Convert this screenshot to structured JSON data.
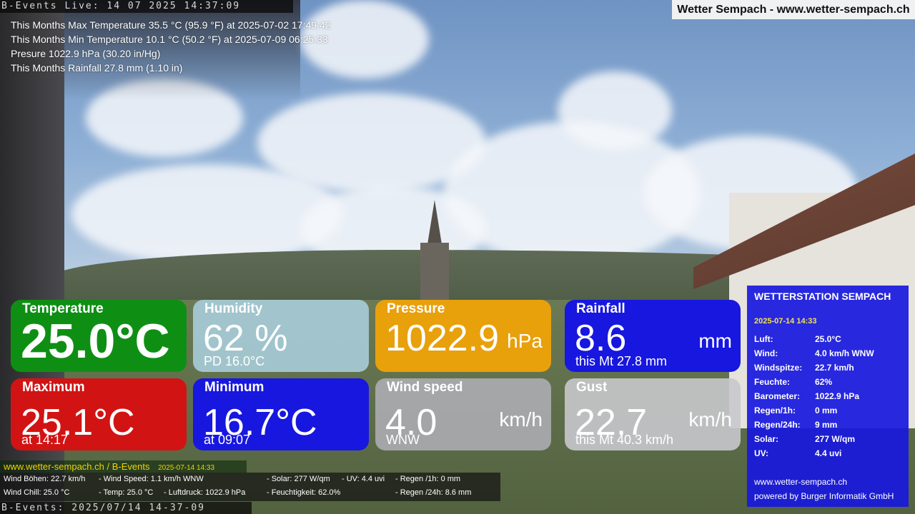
{
  "top_timestamp": "B-Events Live: 14 07 2025 14:37:09",
  "site_banner": "Wetter Sempach - www.wetter-sempach.ch",
  "stats": [
    "This Months Max Temperature 35.5 °C (95.9 °F) at 2025-07-02 17:49:42",
    "This Months Min Temperature 10.1 °C (50.2 °F) at 2025-07-09 06:25:33",
    "Presure 1022.9 hPa (30.20 in/Hg)",
    "This Months Rainfall 27.8 mm (1.10 in)"
  ],
  "tiles": {
    "temperature": {
      "title": "Temperature",
      "value": "25.0°C"
    },
    "humidity": {
      "title": "Humidity",
      "value": "62 %",
      "sub": "PD 16.0°C"
    },
    "pressure": {
      "title": "Pressure",
      "value": "1022.9",
      "unit": "hPa"
    },
    "rainfall": {
      "title": "Rainfall",
      "value": "8.6",
      "unit": "mm",
      "sub": "this Mt 27.8 mm"
    },
    "maximum": {
      "title": "Maximum",
      "value": "25.1°C",
      "sub": "at 14:17"
    },
    "minimum": {
      "title": "Minimum",
      "value": "16.7°C",
      "sub": "at 09:07"
    },
    "wind_speed": {
      "title": "Wind speed",
      "value": "4.0",
      "unit": "km/h",
      "sub": "WNW"
    },
    "gust": {
      "title": "Gust",
      "value": "22.7",
      "unit": "km/h",
      "sub": "this Mt 40.3 km/h"
    }
  },
  "station": {
    "title": "WETTERSTATION SEMPACH",
    "datetime": "2025-07-14 14:33",
    "rows": [
      {
        "label": "Luft:",
        "value": "25.0°C"
      },
      {
        "label": "Wind:",
        "value": "4.0 km/h  WNW"
      },
      {
        "label": "Windspitze:",
        "value": "22.7 km/h"
      },
      {
        "label": "Feuchte:",
        "value": "62%"
      },
      {
        "label": "Barometer:",
        "value": "1022.9 hPa"
      },
      {
        "label": "Regen/1h:",
        "value": "0 mm"
      },
      {
        "label": "Regen/24h:",
        "value": "9 mm"
      },
      {
        "label": "Solar:",
        "value": "277 W/qm"
      },
      {
        "label": "UV:",
        "value": "4.4 uvi"
      }
    ],
    "footer_url": "www.wetter-sempach.ch",
    "footer_credit": "powered by Burger Informatik GmbH"
  },
  "ticker": {
    "header": "www.wetter-sempach.ch / B-Events",
    "header_date": "2025-07-14 14:33",
    "line1": {
      "a": "Wind Böhen: 22.7 km/h",
      "b": "- Wind Speed: 1.1 km/h WNW",
      "c": "- Solar: 277 W/qm",
      "d": "- UV: 4.4 uvi",
      "e": "- Regen /1h:   0 mm"
    },
    "line2": {
      "a": "Wind Chill: 25.0 °C",
      "b": "- Temp: 25.0 °C",
      "c": "- Luftdruck: 1022.9 hPa",
      "d": "- Feuchtigkeit: 62.0%",
      "e": "- Regen /24h: 8.6 mm"
    }
  },
  "bottom_timestamp": "B-Events: 2025/07/14 14-37-09"
}
